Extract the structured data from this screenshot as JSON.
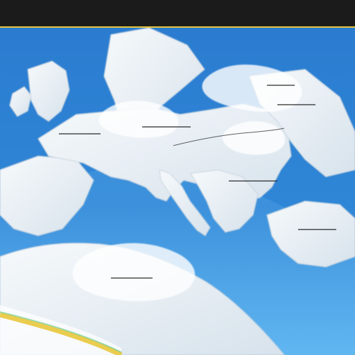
{
  "header": {
    "text": ""
  },
  "colors": {
    "sea": "#2f86d6",
    "sea_light": "#6bb7f2",
    "land": "#eef3f7",
    "land_shadow": "#cfd9e3",
    "top_bar": "#1b1b1b",
    "accent_yellow": "#e8c63c"
  },
  "map": {
    "legend": []
  }
}
